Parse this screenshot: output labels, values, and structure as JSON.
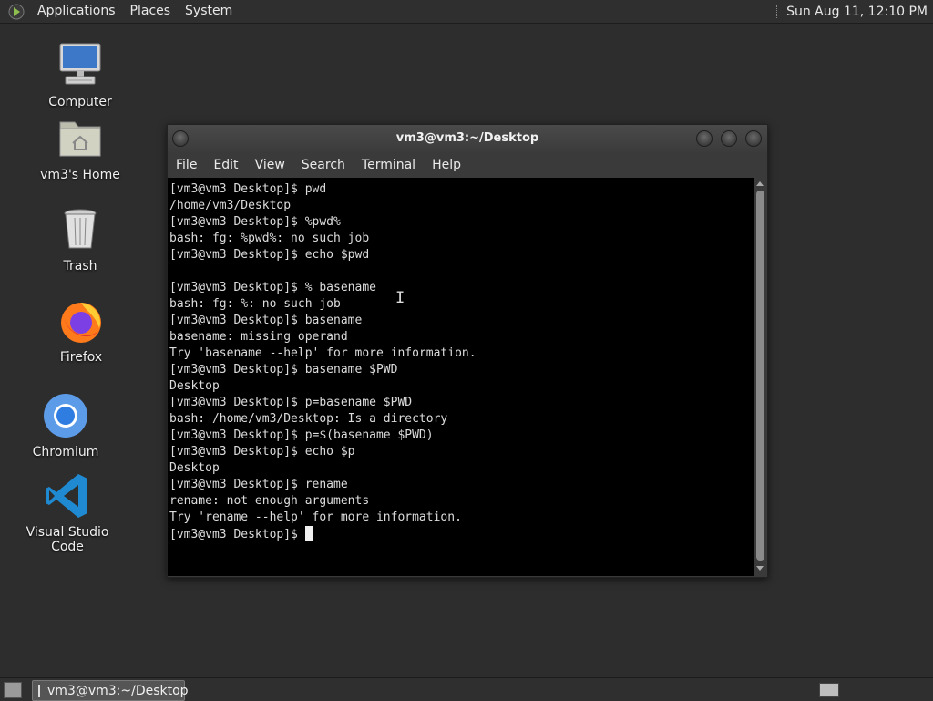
{
  "top_panel": {
    "menus": [
      "Applications",
      "Places",
      "System"
    ],
    "clock": "Sun Aug 11, 12:10 PM"
  },
  "desktop": {
    "icons": [
      {
        "label": "Computer",
        "icon": "computer-icon"
      },
      {
        "label": "vm3's Home",
        "icon": "home-folder-icon"
      },
      {
        "label": "Trash",
        "icon": "trash-icon"
      },
      {
        "label": "Firefox",
        "icon": "firefox-icon"
      },
      {
        "label": "Chromium",
        "icon": "chromium-icon"
      },
      {
        "label": "Visual Studio Code",
        "icon": "vscode-icon"
      }
    ]
  },
  "terminal": {
    "title": "vm3@vm3:~/Desktop",
    "menu": [
      "File",
      "Edit",
      "View",
      "Search",
      "Terminal",
      "Help"
    ],
    "lines": [
      "[vm3@vm3 Desktop]$ pwd",
      "/home/vm3/Desktop",
      "[vm3@vm3 Desktop]$ %pwd%",
      "bash: fg: %pwd%: no such job",
      "[vm3@vm3 Desktop]$ echo $pwd",
      "",
      "[vm3@vm3 Desktop]$ % basename",
      "bash: fg: %: no such job",
      "[vm3@vm3 Desktop]$ basename",
      "basename: missing operand",
      "Try 'basename --help' for more information.",
      "[vm3@vm3 Desktop]$ basename $PWD",
      "Desktop",
      "[vm3@vm3 Desktop]$ p=basename $PWD",
      "bash: /home/vm3/Desktop: Is a directory",
      "[vm3@vm3 Desktop]$ p=$(basename $PWD)",
      "[vm3@vm3 Desktop]$ echo $p",
      "Desktop",
      "[vm3@vm3 Desktop]$ rename",
      "rename: not enough arguments",
      "Try 'rename --help' for more information."
    ],
    "prompt": "[vm3@vm3 Desktop]$ "
  },
  "taskbar": {
    "task_label": "vm3@vm3:~/Desktop"
  },
  "colors": {
    "desktop_bg": "#2d2d2d",
    "terminal_bg": "#000000",
    "terminal_fg": "#dcdcdc"
  }
}
